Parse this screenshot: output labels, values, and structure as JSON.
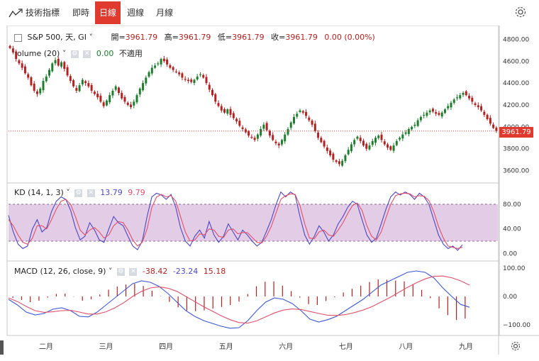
{
  "toolbar": {
    "indicators_label": "技術指標",
    "intervals": [
      "即時",
      "日線",
      "週線",
      "月線"
    ],
    "active_interval": "日線"
  },
  "price_legend": {
    "symbol": "S&P 500, 天, GI",
    "open_label": "開=",
    "open": "3961.79",
    "high_label": "高=",
    "high": "3961.79",
    "low_label": "低=",
    "low": "3961.79",
    "close_label": "收=",
    "close": "3961.79",
    "change": "0.00 (0.00%)"
  },
  "volume_legend": {
    "label": "olume (20)",
    "value": "0.00",
    "note": "不適用"
  },
  "kd_legend": {
    "label": "KD (14, 1, 3)",
    "k": "13.79",
    "d": "9.79"
  },
  "macd_legend": {
    "label": "MACD (12, 26, close, 9)",
    "macd": "-38.42",
    "signal": "-23.24",
    "hist": "15.18"
  },
  "last_price_tag": "3961.79",
  "colors": {
    "up": "#1f7e2e",
    "down": "#b22222",
    "accent": "#e03a2f",
    "k_line": "#4b46c4",
    "d_line": "#e0506a",
    "band": "#dcbfe0"
  },
  "chart_data": [
    {
      "type": "candlestick",
      "title": "S&P 500",
      "ylim": [
        3500,
        4900
      ],
      "yticks": [
        3600,
        3800,
        4000,
        4200,
        4400,
        4600,
        4800
      ],
      "ytick_labels": [
        "3600.00",
        "3800.00",
        "4000.00",
        "4200.00",
        "4400.00",
        "4600.00",
        "4800.00"
      ],
      "x_labels": [
        "二月",
        "三月",
        "四月",
        "五月",
        "六月",
        "七月",
        "八月",
        "九月"
      ],
      "last_price": 3961.79,
      "close": [
        4720,
        4680,
        4620,
        4580,
        4540,
        4490,
        4450,
        4380,
        4330,
        4300,
        4350,
        4420,
        4460,
        4520,
        4580,
        4610,
        4560,
        4590,
        4530,
        4470,
        4420,
        4370,
        4330,
        4380,
        4430,
        4400,
        4370,
        4330,
        4300,
        4270,
        4230,
        4190,
        4240,
        4290,
        4330,
        4370,
        4310,
        4260,
        4230,
        4200,
        4180,
        4230,
        4290,
        4350,
        4400,
        4450,
        4500,
        4540,
        4560,
        4580,
        4620,
        4600,
        4570,
        4540,
        4520,
        4500,
        4480,
        4450,
        4430,
        4420,
        4410,
        4430,
        4460,
        4480,
        4450,
        4400,
        4340,
        4290,
        4230,
        4190,
        4150,
        4130,
        4160,
        4110,
        4080,
        4050,
        4010,
        3980,
        3950,
        3920,
        3900,
        3880,
        3930,
        3980,
        4020,
        3970,
        3920,
        3880,
        3850,
        3830,
        3880,
        3930,
        3980,
        4040,
        4090,
        4120,
        4150,
        4130,
        4100,
        4060,
        4020,
        3960,
        3900,
        3860,
        3820,
        3780,
        3740,
        3700,
        3680,
        3660,
        3690,
        3740,
        3790,
        3840,
        3880,
        3910,
        3870,
        3830,
        3800,
        3830,
        3870,
        3900,
        3920,
        3880,
        3840,
        3810,
        3790,
        3830,
        3870,
        3900,
        3930,
        3950,
        3980,
        4000,
        4020,
        4060,
        4090,
        4110,
        4130,
        4150,
        4140,
        4120,
        4110,
        4130,
        4160,
        4190,
        4220,
        4250,
        4270,
        4290,
        4310,
        4290,
        4260,
        4230,
        4200,
        4180,
        4150,
        4110,
        4070,
        4030,
        3990,
        3962
      ]
    },
    {
      "type": "line",
      "title": "KD (14, 1, 3)",
      "ylim": [
        -10,
        110
      ],
      "yticks": [
        0,
        40,
        80
      ],
      "ytick_labels": [
        "0.00",
        "40.00",
        "80.00"
      ],
      "band": [
        20,
        80
      ],
      "series": [
        {
          "name": "K",
          "values": [
            62,
            35,
            15,
            8,
            12,
            40,
            55,
            35,
            42,
            68,
            85,
            92,
            88,
            70,
            42,
            22,
            28,
            50,
            38,
            22,
            18,
            40,
            60,
            50,
            45,
            28,
            12,
            6,
            20,
            60,
            92,
            98,
            95,
            88,
            96,
            75,
            42,
            20,
            12,
            28,
            38,
            25,
            52,
            30,
            18,
            28,
            48,
            35,
            22,
            38,
            30,
            20,
            12,
            18,
            36,
            55,
            80,
            100,
            92,
            100,
            95,
            60,
            30,
            15,
            28,
            45,
            35,
            20,
            30,
            48,
            60,
            75,
            85,
            80,
            55,
            30,
            18,
            25,
            48,
            72,
            92,
            100,
            95,
            100,
            96,
            88,
            98,
            92,
            80,
            55,
            30,
            15,
            8,
            12,
            5,
            14
          ]
        },
        {
          "name": "D",
          "values": [
            55,
            45,
            30,
            18,
            15,
            25,
            45,
            45,
            40,
            55,
            72,
            85,
            88,
            80,
            60,
            38,
            30,
            38,
            42,
            35,
            25,
            30,
            45,
            52,
            50,
            38,
            22,
            12,
            18,
            40,
            75,
            92,
            96,
            92,
            94,
            85,
            60,
            35,
            20,
            22,
            32,
            30,
            40,
            38,
            28,
            26,
            38,
            40,
            32,
            34,
            34,
            26,
            18,
            17,
            28,
            44,
            66,
            88,
            94,
            97,
            96,
            78,
            48,
            25,
            24,
            35,
            38,
            30,
            28,
            38,
            50,
            65,
            78,
            82,
            70,
            45,
            28,
            22,
            35,
            58,
            80,
            94,
            97,
            98,
            97,
            92,
            94,
            93,
            86,
            68,
            44,
            25,
            12,
            10,
            8,
            10
          ]
        }
      ]
    },
    {
      "type": "line",
      "title": "MACD (12, 26, close, 9)",
      "ylim": [
        -130,
        115
      ],
      "yticks": [
        -100,
        0,
        100
      ],
      "ytick_labels": [
        "−100.00",
        "0.00",
        "100.00"
      ],
      "series": [
        {
          "name": "MACD",
          "values": [
            -10,
            -30,
            -55,
            -65,
            -60,
            -45,
            -40,
            -50,
            -70,
            -72,
            -55,
            -30,
            -5,
            20,
            45,
            55,
            50,
            35,
            10,
            -20,
            -50,
            -70,
            -85,
            -95,
            -105,
            -112,
            -110,
            -85,
            -50,
            -20,
            -5,
            -10,
            -25,
            -50,
            -80,
            -90,
            -82,
            -70,
            -50,
            -30,
            -10,
            15,
            40,
            55,
            70,
            85,
            90,
            85,
            65,
            30,
            0,
            -28,
            -38
          ]
        },
        {
          "name": "Signal",
          "values": [
            -5,
            -18,
            -35,
            -50,
            -56,
            -54,
            -50,
            -49,
            -55,
            -62,
            -62,
            -54,
            -40,
            -22,
            0,
            18,
            30,
            34,
            29,
            18,
            0,
            -18,
            -36,
            -52,
            -68,
            -82,
            -92,
            -94,
            -86,
            -72,
            -58,
            -48,
            -44,
            -46,
            -53,
            -60,
            -66,
            -67,
            -64,
            -57,
            -48,
            -36,
            -20,
            -4,
            14,
            32,
            48,
            62,
            71,
            72,
            66,
            55,
            40
          ]
        }
      ],
      "histogram": [
        -5,
        -12,
        -20,
        -15,
        -4,
        9,
        10,
        -1,
        -15,
        -10,
        7,
        24,
        35,
        42,
        45,
        37,
        20,
        1,
        -19,
        -38,
        -50,
        -52,
        -49,
        -43,
        -37,
        -30,
        -18,
        9,
        36,
        52,
        53,
        38,
        19,
        -4,
        -27,
        -30,
        -16,
        -3,
        14,
        27,
        38,
        51,
        60,
        59,
        56,
        53,
        42,
        23,
        -6,
        -42,
        -66,
        -83,
        -78
      ]
    }
  ]
}
